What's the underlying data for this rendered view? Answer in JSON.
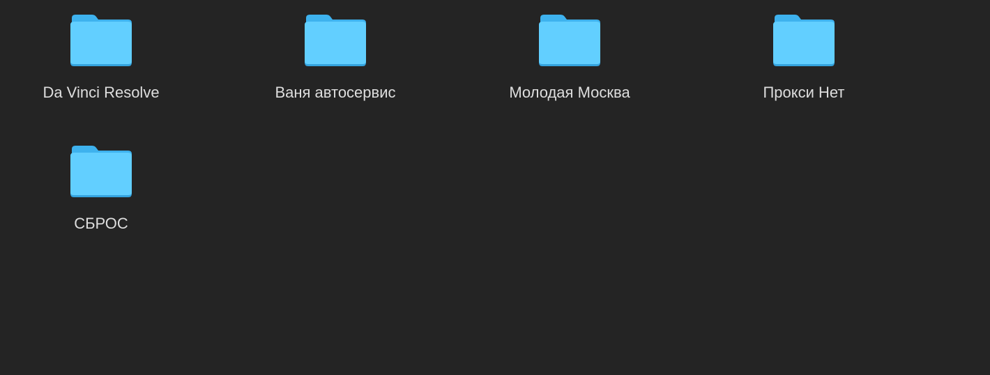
{
  "folders": [
    {
      "name": "Da Vinci Resolve",
      "icon": "folder-icon"
    },
    {
      "name": "Ваня автосервис",
      "icon": "folder-icon"
    },
    {
      "name": "Молодая Москва",
      "icon": "folder-icon"
    },
    {
      "name": "Прокси Нет",
      "icon": "folder-icon"
    },
    {
      "name": "СБРОС",
      "icon": "folder-icon"
    }
  ],
  "colors": {
    "background": "#242424",
    "folder_body": "#62CFFF",
    "folder_back": "#3EB2EE",
    "folder_shadow": "#34A3DE",
    "label_text": "#DEDEDE"
  }
}
